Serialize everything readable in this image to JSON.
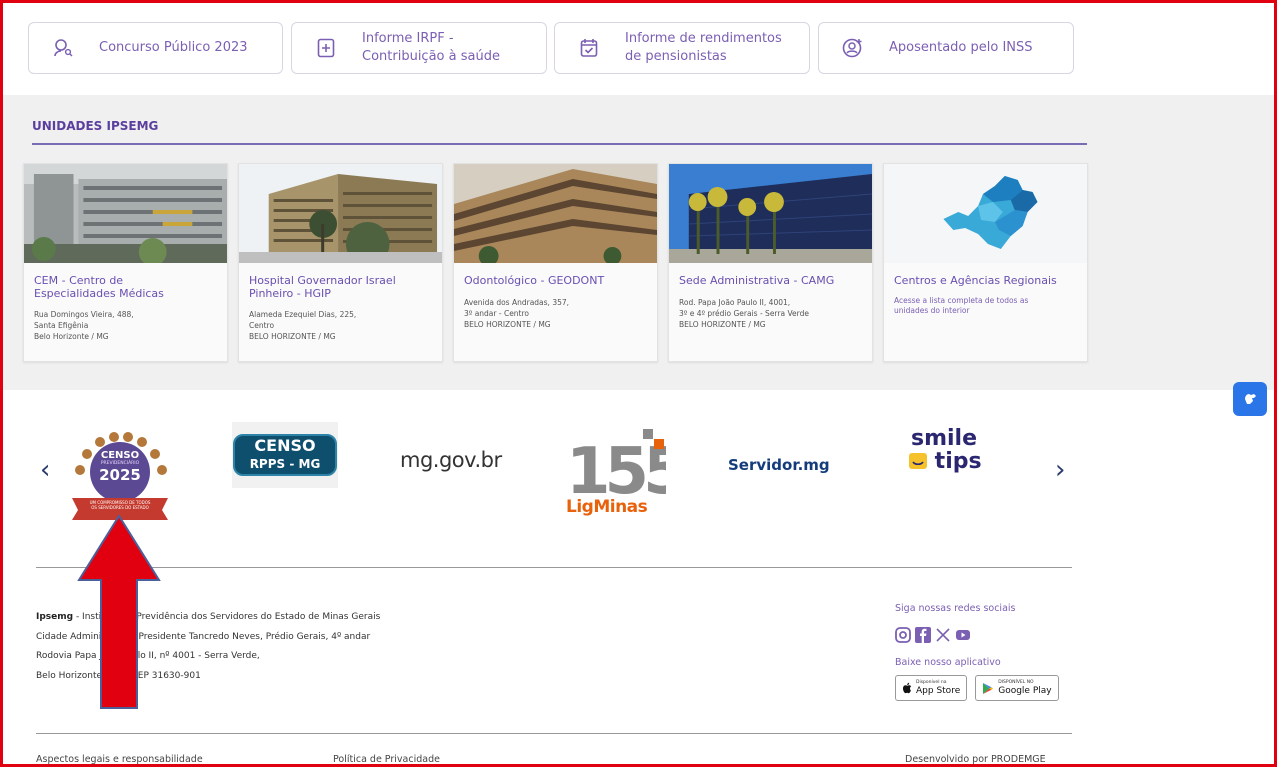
{
  "quick_links": [
    {
      "label": "Concurso Público 2023",
      "icon": "person-search-icon"
    },
    {
      "label": "Informe IRPF -\nContribuição à saúde",
      "icon": "document-plus-icon"
    },
    {
      "label": "Informe de rendimentos\nde pensionistas",
      "icon": "calendar-check-icon"
    },
    {
      "label": "Aposentado pelo INSS",
      "icon": "person-add-icon"
    }
  ],
  "units": {
    "title": "UNIDADES IPSEMG",
    "cards": [
      {
        "title": "CEM - Centro de\nEspecialidades Médicas",
        "lines": [
          "Rua Domingos Vieira, 488,",
          "Santa Efigênia",
          "Belo Horizonte / MG"
        ]
      },
      {
        "title": "Hospital Governador Israel\nPinheiro - HGIP",
        "lines": [
          "Alameda Ezequiel Dias, 225,",
          "Centro",
          "BELO HORIZONTE / MG"
        ]
      },
      {
        "title": "Odontológico - GEODONT",
        "lines": [
          "Avenida dos Andradas, 357,",
          "3º andar - Centro",
          "BELO HORIZONTE / MG"
        ]
      },
      {
        "title": "Sede Administrativa - CAMG",
        "lines": [
          "Rod. Papa João Paulo II, 4001,",
          "3º e 4º prédio Gerais - Serra Verde",
          "BELO HORIZONTE / MG"
        ]
      },
      {
        "title": "Centros e Agências Regionais",
        "desc": "Acesse a lista completa de todos as\nunidades do interior"
      }
    ]
  },
  "partners": {
    "censo2025": {
      "top": "CENSO",
      "mid": "PREVIDENCIÁRIO",
      "year": "2025",
      "ribbon": "UM COMPROMISSO DE TODOS\nOS SERVIDORES DO ESTADO"
    },
    "censo_rpps": {
      "line1": "CENSO",
      "line2": "RPPS - MG"
    },
    "mggov": "mg.gov.br",
    "ligminas": {
      "number": "155",
      "name": "LigMinas"
    },
    "servidor": "Servidor.mg",
    "smile": {
      "line1": "smile",
      "line2": "tips"
    }
  },
  "footer": {
    "org_name": "Ipsemg",
    "org_rest": " - Instituto de Previdência dos Servidores do Estado de Minas Gerais",
    "address_lines": [
      "Cidade Administrativa Presidente Tancredo Neves, Prédio Gerais, 4º andar",
      "Rodovia Papa João Paulo II, nº 4001 - Serra Verde,",
      "Belo Horizonte - MG, CEP 31630-901"
    ],
    "social_title": "Siga nossas redes sociais",
    "app_title": "Baixe nosso aplicativo",
    "app_store_small": "Disponível na",
    "app_store": "App Store",
    "google_small": "DISPONÍVEL NO",
    "google_play": "Google Play",
    "legal": "Aspectos legais e responsabilidade",
    "privacy": "Política de Privacidade",
    "developed": "Desenvolvido por PRODEMGE"
  },
  "colors": {
    "accent": "#7b5fb3",
    "title": "#5b3f9e",
    "frame": "#e0000f"
  }
}
